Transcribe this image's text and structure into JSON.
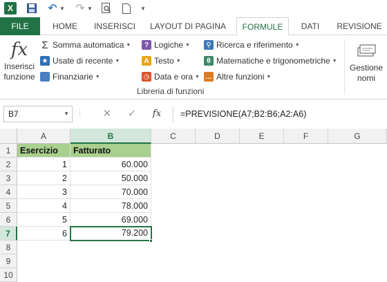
{
  "qat": {
    "logo": "X"
  },
  "tabs": [
    {
      "label": "FILE"
    },
    {
      "label": "HOME"
    },
    {
      "label": "INSERISCI"
    },
    {
      "label": "LAYOUT DI PAGINA"
    },
    {
      "label": "FORMULE"
    },
    {
      "label": "DATI"
    },
    {
      "label": "REVISIONE"
    }
  ],
  "ribbon": {
    "insert_function_line1": "Inserisci",
    "insert_function_line2": "funzione",
    "col1": [
      "Somma automatica",
      "Usate di recente",
      "Finanziarie"
    ],
    "col2": [
      "Logiche",
      "Testo",
      "Data e ora"
    ],
    "col3": [
      "Ricerca e riferimento",
      "Matematiche e trigonometriche",
      "Altre funzioni"
    ],
    "group_label": "Libreria di funzioni",
    "name_manager_line1": "Gestione",
    "name_manager_line2": "nomi",
    "accent_green": "#217346"
  },
  "formula_bar": {
    "name_box": "B7",
    "formula": "=PREVISIONE(A7;B2:B6;A2:A6)"
  },
  "sheet": {
    "columns": [
      "A",
      "B",
      "C",
      "D",
      "E",
      "F",
      "G"
    ],
    "rows": [
      "1",
      "2",
      "3",
      "4",
      "5",
      "6",
      "7",
      "8",
      "9",
      "10"
    ],
    "header": [
      "Esercizio",
      "Fatturato"
    ],
    "data": [
      [
        "1",
        "60.000"
      ],
      [
        "2",
        "50.000"
      ],
      [
        "3",
        "70.000"
      ],
      [
        "4",
        "78.000"
      ],
      [
        "5",
        "69.000"
      ],
      [
        "6",
        "79.200"
      ]
    ],
    "header_fill": "#a9d08e"
  }
}
